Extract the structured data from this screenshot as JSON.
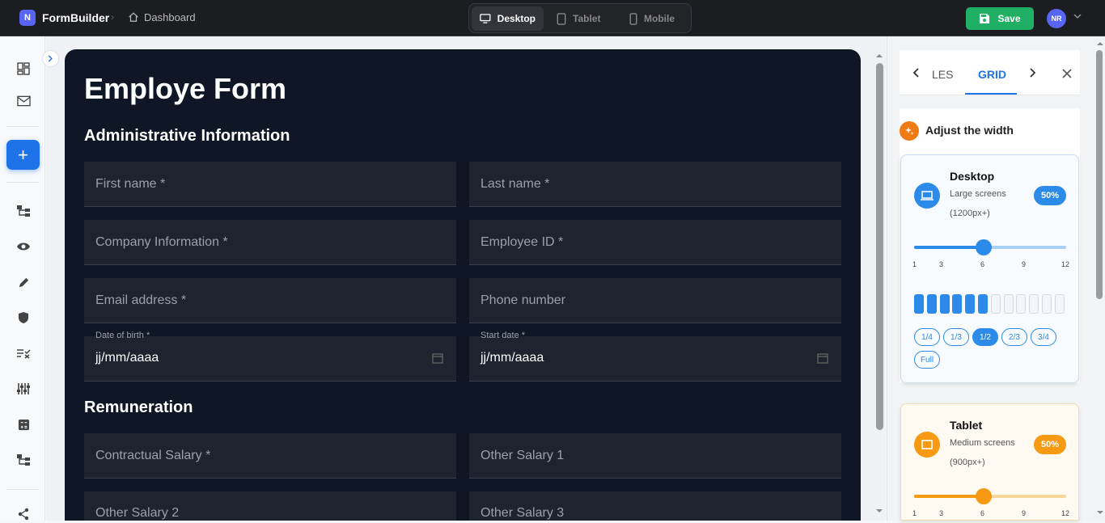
{
  "topbar": {
    "logo_letter": "N",
    "brand": "FormBuilder",
    "breadcrumb": "Dashboard",
    "devices": [
      "Desktop",
      "Tablet",
      "Mobile"
    ],
    "active_device": "Desktop",
    "save_label": "Save",
    "avatar": "NR"
  },
  "form": {
    "title": "Employe Form",
    "sections": [
      "Administrative Information",
      "Remuneration"
    ],
    "fields": {
      "first_name": "First name *",
      "last_name": "Last name *",
      "company": "Company Information *",
      "employee_id": "Employee ID *",
      "email": "Email address *",
      "phone": "Phone number",
      "dob_label": "Date of birth *",
      "dob_value": "jj/mm/aaaa",
      "start_label": "Start date *",
      "start_value": "jj/mm/aaaa",
      "salary": "Contractual Salary *",
      "other1": "Other Salary 1",
      "other2": "Other Salary 2",
      "other3": "Other Salary 3"
    }
  },
  "panel": {
    "tab_partial": "LES",
    "tab_active": "GRID",
    "adjust_title": "Adjust the width",
    "desktop": {
      "title": "Desktop",
      "sub": "Large screens",
      "range": "(1200px+)",
      "percent": "50%",
      "value": 6,
      "ticks": [
        "1",
        "3",
        "6",
        "9",
        "12"
      ],
      "fractions": [
        "1/4",
        "1/3",
        "1/2",
        "2/3",
        "3/4",
        "Full"
      ],
      "selected_fraction": "1/2",
      "accent": "#2c8be8"
    },
    "tablet": {
      "title": "Tablet",
      "sub": "Medium screens",
      "range": "(900px+)",
      "percent": "50%",
      "value": 6,
      "ticks": [
        "1",
        "3",
        "6",
        "9",
        "12"
      ],
      "accent": "#f59a12"
    }
  }
}
